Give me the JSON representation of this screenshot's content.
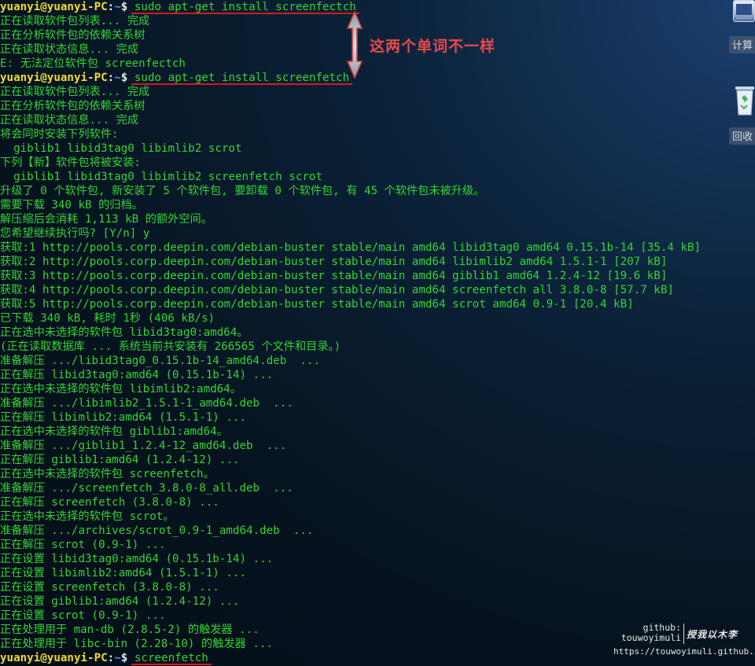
{
  "prompt": {
    "user_host": "yuanyi@yuanyi-PC",
    "separator": ":",
    "path": "~",
    "symbol": "$"
  },
  "terminal": {
    "lines": [
      {
        "type": "prompt",
        "command": "sudo apt-get install screenfectch"
      },
      {
        "type": "text",
        "text": "正在读取软件包列表... 完成"
      },
      {
        "type": "text",
        "text": "正在分析软件包的依赖关系树"
      },
      {
        "type": "text",
        "text": "正在读取状态信息... 完成"
      },
      {
        "type": "text",
        "text": "E: 无法定位软件包 screenfectch"
      },
      {
        "type": "prompt",
        "command": "sudo apt-get install screenfetch"
      },
      {
        "type": "text",
        "text": "正在读取软件包列表... 完成"
      },
      {
        "type": "text",
        "text": "正在分析软件包的依赖关系树"
      },
      {
        "type": "text",
        "text": "正在读取状态信息... 完成"
      },
      {
        "type": "text",
        "text": "将会同时安装下列软件:"
      },
      {
        "type": "text",
        "text": "  giblib1 libid3tag0 libimlib2 scrot"
      },
      {
        "type": "text",
        "text": "下列【新】软件包将被安装:"
      },
      {
        "type": "text",
        "text": "  giblib1 libid3tag0 libimlib2 screenfetch scrot"
      },
      {
        "type": "text",
        "text": "升级了 0 个软件包, 新安装了 5 个软件包, 要卸载 0 个软件包, 有 45 个软件包未被升级。"
      },
      {
        "type": "text",
        "text": "需要下载 340 kB 的归档。"
      },
      {
        "type": "text",
        "text": "解压缩后会消耗 1,113 kB 的额外空间。"
      },
      {
        "type": "text",
        "text": "您希望继续执行吗? [Y/n] y"
      },
      {
        "type": "text",
        "text": "获取:1 http://pools.corp.deepin.com/debian-buster stable/main amd64 libid3tag0 amd64 0.15.1b-14 [35.4 kB]"
      },
      {
        "type": "text",
        "text": "获取:2 http://pools.corp.deepin.com/debian-buster stable/main amd64 libimlib2 amd64 1.5.1-1 [207 kB]"
      },
      {
        "type": "text",
        "text": "获取:3 http://pools.corp.deepin.com/debian-buster stable/main amd64 giblib1 amd64 1.2.4-12 [19.6 kB]"
      },
      {
        "type": "text",
        "text": "获取:4 http://pools.corp.deepin.com/debian-buster stable/main amd64 screenfetch all 3.8.0-8 [57.7 kB]"
      },
      {
        "type": "text",
        "text": "获取:5 http://pools.corp.deepin.com/debian-buster stable/main amd64 scrot amd64 0.9-1 [20.4 kB]"
      },
      {
        "type": "text",
        "text": "已下载 340 kB, 耗时 1秒 (406 kB/s)"
      },
      {
        "type": "text",
        "text": "正在选中未选择的软件包 libid3tag0:amd64。"
      },
      {
        "type": "text",
        "text": "(正在读取数据库 ... 系统当前共安装有 266565 个文件和目录。)"
      },
      {
        "type": "text",
        "text": "准备解压 .../libid3tag0_0.15.1b-14_amd64.deb  ..."
      },
      {
        "type": "text",
        "text": "正在解压 libid3tag0:amd64 (0.15.1b-14) ..."
      },
      {
        "type": "text",
        "text": "正在选中未选择的软件包 libimlib2:amd64。"
      },
      {
        "type": "text",
        "text": "准备解压 .../libimlib2_1.5.1-1_amd64.deb  ..."
      },
      {
        "type": "text",
        "text": "正在解压 libimlib2:amd64 (1.5.1-1) ..."
      },
      {
        "type": "text",
        "text": "正在选中未选择的软件包 giblib1:amd64。"
      },
      {
        "type": "text",
        "text": "准备解压 .../giblib1_1.2.4-12_amd64.deb  ..."
      },
      {
        "type": "text",
        "text": "正在解压 giblib1:amd64 (1.2.4-12) ..."
      },
      {
        "type": "text",
        "text": "正在选中未选择的软件包 screenfetch。"
      },
      {
        "type": "text",
        "text": "准备解压 .../screenfetch_3.8.0-8_all.deb  ..."
      },
      {
        "type": "text",
        "text": "正在解压 screenfetch (3.8.0-8) ..."
      },
      {
        "type": "text",
        "text": "正在选中未选择的软件包 scrot。"
      },
      {
        "type": "text",
        "text": "准备解压 .../archives/scrot_0.9-1_amd64.deb  ..."
      },
      {
        "type": "text",
        "text": "正在解压 scrot (0.9-1) ..."
      },
      {
        "type": "text",
        "text": "正在设置 libid3tag0:amd64 (0.15.1b-14) ..."
      },
      {
        "type": "text",
        "text": "正在设置 libimlib2:amd64 (1.5.1-1) ..."
      },
      {
        "type": "text",
        "text": "正在设置 screenfetch (3.8.0-8) ..."
      },
      {
        "type": "text",
        "text": "正在设置 giblib1:amd64 (1.2.4-12) ..."
      },
      {
        "type": "text",
        "text": "正在设置 scrot (0.9-1) ..."
      },
      {
        "type": "text",
        "text": "正在处理用于 man-db (2.8.5-2) 的触发器 ..."
      },
      {
        "type": "text",
        "text": "正在处理用于 libc-bin (2.28-10) 的触发器 ..."
      },
      {
        "type": "prompt",
        "command": "screenfetch"
      }
    ]
  },
  "annotation": {
    "text": "这两个单词不一样",
    "color": "#e64a4a"
  },
  "desktop": {
    "icons": [
      {
        "icon": "calculator-icon",
        "label": "计算"
      },
      {
        "icon": "trash-icon",
        "label": "回收"
      }
    ]
  },
  "watermark": {
    "label": "github:",
    "user": "touwoyimuli",
    "motto": "授我以木李",
    "url": "https://touwoyimuli.github.io"
  },
  "colors": {
    "terminal_text": "#35d435",
    "prompt_user": "#f0dc2a",
    "prompt_path": "#5d8cf5",
    "underline": "#d01c1c"
  }
}
